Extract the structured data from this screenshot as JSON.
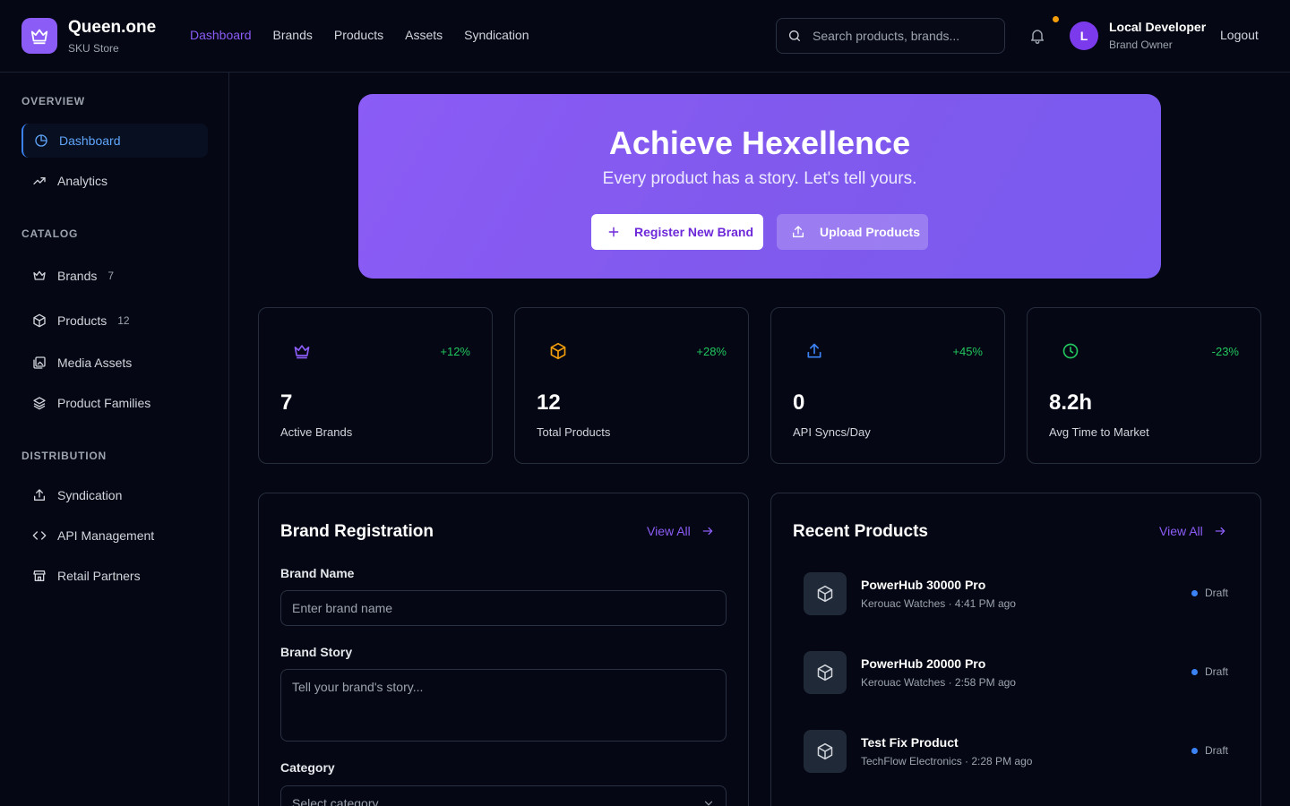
{
  "app": {
    "name": "Queen.one",
    "subtitle": "SKU Store",
    "logo_icon": "crown-icon",
    "accent": "#8b5cf6"
  },
  "topnav": [
    {
      "label": "Dashboard",
      "active": true
    },
    {
      "label": "Brands"
    },
    {
      "label": "Products"
    },
    {
      "label": "Assets"
    },
    {
      "label": "Syndication"
    }
  ],
  "search": {
    "placeholder": "Search products, brands...",
    "value": ""
  },
  "user": {
    "initial": "L",
    "name": "Local Developer",
    "role": "Brand Owner",
    "logout_label": "Logout"
  },
  "sidebar": {
    "overview_title": "OVERVIEW",
    "catalog_title": "CATALOG",
    "distribution_title": "DISTRIBUTION",
    "overview": [
      {
        "label": "Dashboard",
        "icon": "pie-chart-icon",
        "active": true
      },
      {
        "label": "Analytics",
        "icon": "trending-up-icon"
      }
    ],
    "catalog": [
      {
        "label": "Brands",
        "icon": "crown-icon",
        "count": "7"
      },
      {
        "label": "Products",
        "icon": "package-icon",
        "count": "12"
      },
      {
        "label": "Media Assets",
        "icon": "images-icon"
      },
      {
        "label": "Product Families",
        "icon": "layers-icon"
      }
    ],
    "distribution": [
      {
        "label": "Syndication",
        "icon": "upload-icon"
      },
      {
        "label": "API Management",
        "icon": "code-icon"
      },
      {
        "label": "Retail Partners",
        "icon": "store-icon"
      }
    ]
  },
  "hero": {
    "title": "Achieve Hexellence",
    "subtitle": "Every product has a story. Let's tell yours.",
    "primary_label": "Register New Brand",
    "secondary_label": "Upload Products"
  },
  "stats": [
    {
      "icon": "crown-icon",
      "color": "#8b5cf6",
      "change": "+12%",
      "value": "7",
      "label": "Active Brands"
    },
    {
      "icon": "package-icon",
      "color": "#f59e0b",
      "change": "+28%",
      "value": "12",
      "label": "Total Products"
    },
    {
      "icon": "upload-icon",
      "color": "#3b82f6",
      "change": "+45%",
      "value": "0",
      "label": "API Syncs/Day"
    },
    {
      "icon": "clock-icon",
      "color": "#22c55e",
      "change": "-23%",
      "value": "8.2h",
      "label": "Avg Time to Market"
    }
  ],
  "brand_registration": {
    "title": "Brand Registration",
    "view_all": "View All",
    "name_label": "Brand Name",
    "name_placeholder": "Enter brand name",
    "story_label": "Brand Story",
    "story_placeholder": "Tell your brand's story...",
    "category_label": "Category",
    "category_placeholder": "Select category..."
  },
  "recent_products": {
    "title": "Recent Products",
    "view_all": "View All",
    "items": [
      {
        "name": "PowerHub 30000 Pro",
        "meta": "Kerouac Watches · 4:41 PM ago",
        "status": "Draft"
      },
      {
        "name": "PowerHub 20000 Pro",
        "meta": "Kerouac Watches · 2:58 PM ago",
        "status": "Draft"
      },
      {
        "name": "Test Fix Product",
        "meta": "TechFlow Electronics · 2:28 PM ago",
        "status": "Draft"
      }
    ]
  }
}
